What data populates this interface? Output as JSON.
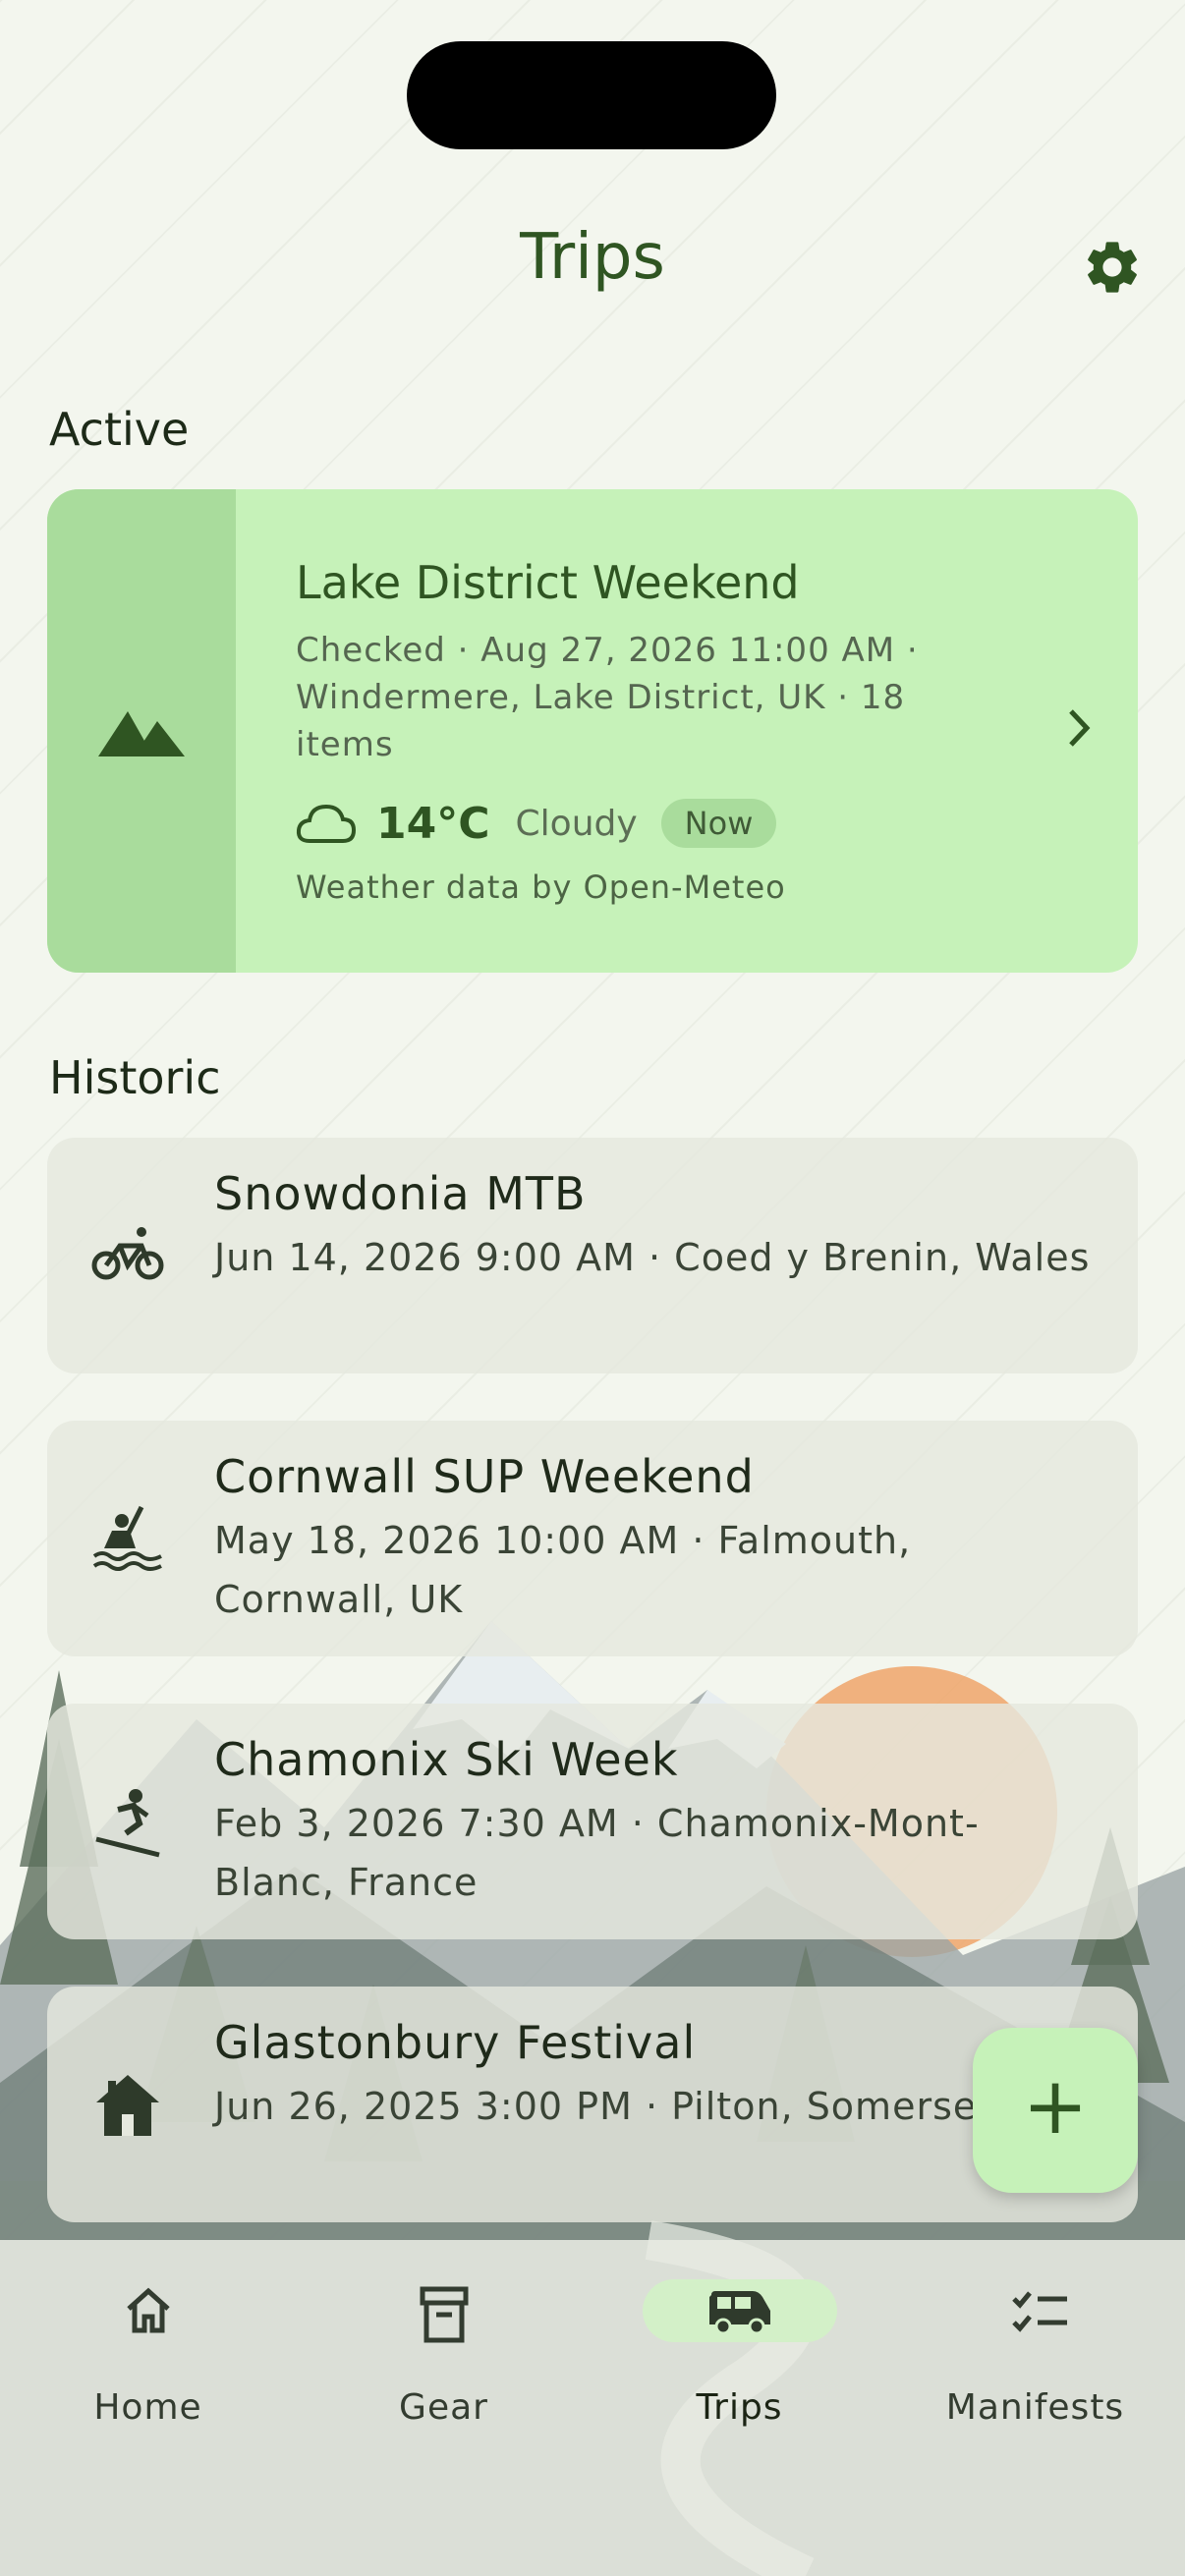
{
  "header": {
    "title": "Trips",
    "settings_icon": "gear-icon"
  },
  "sections": {
    "active_label": "Active",
    "historic_label": "Historic"
  },
  "active_trip": {
    "icon": "mountain-icon",
    "name": "Lake District Weekend",
    "meta": "Checked · Aug 27, 2026 11:00 AM · Windermere, Lake District, UK · 18 items",
    "weather": {
      "icon": "cloud-icon",
      "temperature": "14°C",
      "condition": "Cloudy",
      "badge": "Now",
      "attribution": "Weather data by Open-Meteo"
    }
  },
  "historic_trips": [
    {
      "icon": "bicycle-icon",
      "name": "Snowdonia MTB",
      "meta": "Jun 14, 2026 9:00 AM · Coed y Brenin, Wales"
    },
    {
      "icon": "kayak-icon",
      "name": "Cornwall SUP Weekend",
      "meta": "May 18, 2026 10:00 AM · Falmouth, Cornwall, UK"
    },
    {
      "icon": "skiing-icon",
      "name": "Chamonix Ski Week",
      "meta": "Feb 3, 2026 7:30 AM · Chamonix-Mont-Blanc, France"
    },
    {
      "icon": "cabin-icon",
      "name": "Glastonbury Festival",
      "meta": "Jun 26, 2025 3:00 PM · Pilton, Somerset, UK"
    }
  ],
  "fab": {
    "label": "+"
  },
  "bottom_nav": {
    "selected": "Trips",
    "items": [
      {
        "label": "Home",
        "icon": "home-icon"
      },
      {
        "label": "Gear",
        "icon": "archive-box-icon"
      },
      {
        "label": "Trips",
        "icon": "van-icon"
      },
      {
        "label": "Manifests",
        "icon": "checklist-icon"
      }
    ]
  },
  "colors": {
    "accent": "#2f5522",
    "active_card": "#c6f2b9",
    "active_card_side": "#a9dc9c",
    "sun": "#efa56a",
    "background": "#f3f6ee"
  }
}
